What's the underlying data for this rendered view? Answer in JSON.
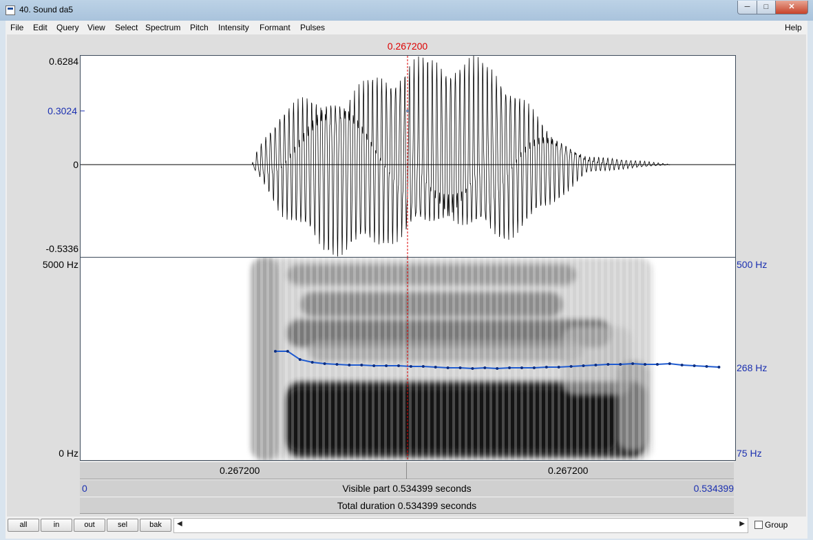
{
  "window": {
    "title": "40. Sound da5",
    "min_icon": "minimize-icon",
    "max_icon": "maximize-icon",
    "close_icon": "close-icon"
  },
  "menubar": {
    "items": [
      "File",
      "Edit",
      "Query",
      "View",
      "Select",
      "Spectrum",
      "Pitch",
      "Intensity",
      "Formant",
      "Pulses"
    ],
    "help": "Help"
  },
  "cursor": {
    "time_label": "0.267200",
    "time": 0.2672,
    "color": "#d00000"
  },
  "waveform": {
    "y_max": "0.6284",
    "y_marker": "0.3024",
    "y_zero": "0",
    "y_min": "-0.5336",
    "y_max_value": 0.6284,
    "y_min_value": -0.5336,
    "y_marker_value": 0.3024
  },
  "spectrogram": {
    "freq_max": "5000 Hz",
    "freq_min": "0 Hz",
    "pitch_max": "500 Hz",
    "pitch_cursor": "268 Hz",
    "pitch_min": "75 Hz",
    "pitch_color": "#1e5ad0"
  },
  "time_bars": {
    "left_cursor": "0.267200",
    "right_cursor": "0.267200",
    "visible_start": "0",
    "visible_label": "Visible part 0.534399 seconds",
    "visible_end": "0.534399",
    "total_label": "Total duration 0.534399 seconds"
  },
  "toolbar": {
    "buttons": [
      "all",
      "in",
      "out",
      "sel",
      "bak"
    ],
    "scroll_left_icon": "scroll-left-icon",
    "scroll_right_icon": "scroll-right-icon",
    "group_label": "Group",
    "group_checked": false
  }
}
